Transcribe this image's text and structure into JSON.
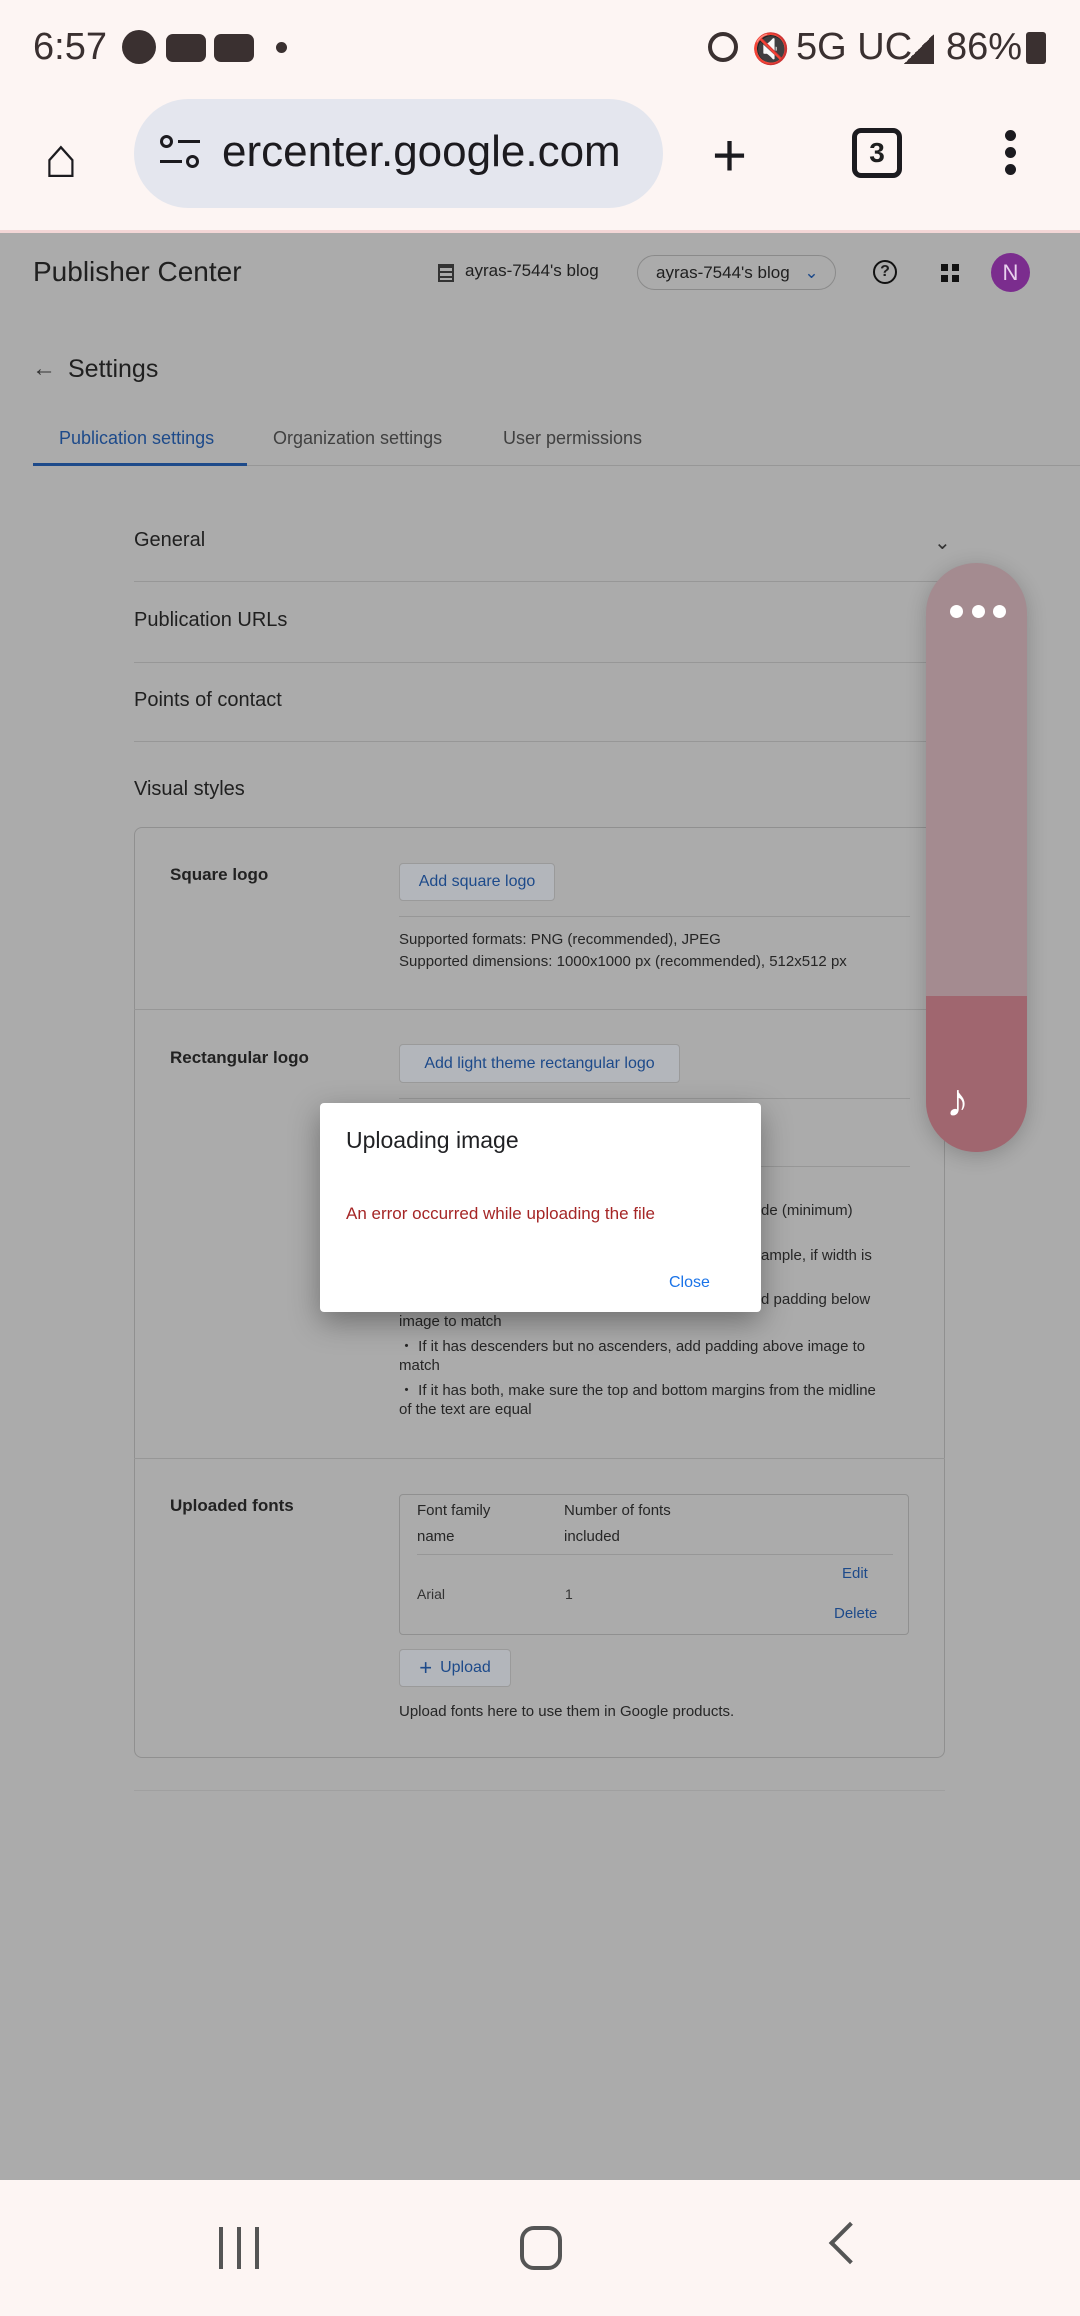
{
  "status_bar": {
    "time": "6:57",
    "network": "5G UC",
    "battery": "86%",
    "icons": [
      "facebook-icon",
      "youtube-icon",
      "youtube-icon",
      "dot-icon",
      "alarm-icon",
      "mute-icon",
      "signal-icon",
      "battery-icon"
    ]
  },
  "browser": {
    "url": "ercenter.google.com",
    "tab_count": "3"
  },
  "header": {
    "title": "Publisher Center",
    "org_name": "ayras-7544's blog",
    "publication_select": "ayras-7544's blog",
    "avatar_letter": "N",
    "avatar_color": "#7b2d8e"
  },
  "page": {
    "title": "Settings",
    "tabs": [
      {
        "label": "Publication settings",
        "active": true
      },
      {
        "label": "Organization settings"
      },
      {
        "label": "User permissions"
      }
    ]
  },
  "sections": [
    "General",
    "Publication URLs",
    "Points of contact",
    "Visual styles"
  ],
  "visual_styles": {
    "square_logo": {
      "label": "Square logo",
      "button": "Add square logo",
      "formats": "Supported formats: PNG (recommended), JPEG",
      "dimensions": "Supported dimensions: 1000x1000 px (recommended), 512x512 px"
    },
    "rectangular_logo": {
      "label": "Rectangular logo",
      "button": "Add light theme rectangular logo",
      "fragments": [
        "de (minimum)",
        "ample, if width is",
        "d padding below"
      ],
      "lines": [
        "image to match",
        "・ If it has descenders but no ascenders, add padding above image to",
        "match",
        "・ If it has both, make sure the top and bottom margins from the midline",
        "of the text are equal"
      ]
    },
    "uploaded_fonts": {
      "label": "Uploaded fonts",
      "headers": [
        "Font family name",
        "Number of fonts included"
      ],
      "header_lines": [
        [
          "Font family",
          "name"
        ],
        [
          "Number of fonts",
          "included"
        ]
      ],
      "rows": [
        {
          "name": "Arial",
          "count": "1",
          "edit": "Edit",
          "delete": "Delete"
        }
      ],
      "upload_button": "Upload",
      "help": "Upload fonts here to use them in Google products."
    }
  },
  "dialog": {
    "title": "Uploading image",
    "error": "An error occurred while uploading the file",
    "close": "Close",
    "error_color": "#a52626"
  }
}
